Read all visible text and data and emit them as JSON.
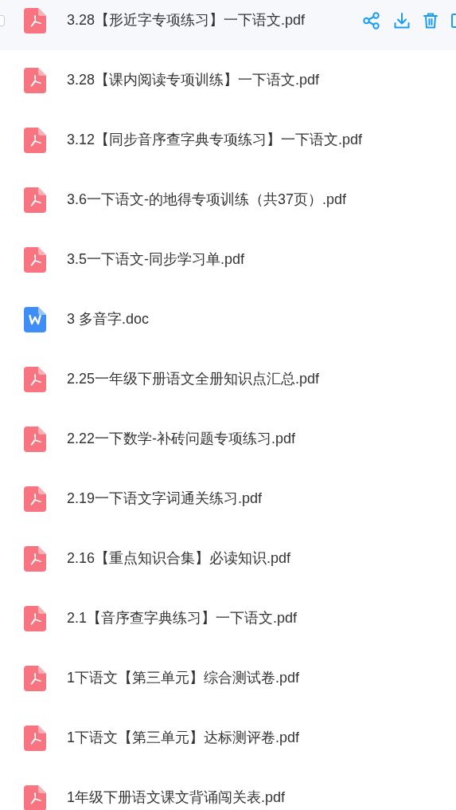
{
  "files": [
    {
      "name": "3.28【形近字专项练习】一下语文.pdf",
      "kind": "pdf",
      "hovered": true
    },
    {
      "name": "3.28【课内阅读专项训练】一下语文.pdf",
      "kind": "pdf",
      "hovered": false
    },
    {
      "name": "3.12【同步音序查字典专项练习】一下语文.pdf",
      "kind": "pdf",
      "hovered": false
    },
    {
      "name": "3.6一下语文-的地得专项训练（共37页）.pdf",
      "kind": "pdf",
      "hovered": false
    },
    {
      "name": "3.5一下语文-同步学习单.pdf",
      "kind": "pdf",
      "hovered": false
    },
    {
      "name": "3 多音字.doc",
      "kind": "doc",
      "hovered": false
    },
    {
      "name": "2.25一年级下册语文全册知识点汇总.pdf",
      "kind": "pdf",
      "hovered": false
    },
    {
      "name": "2.22一下数学-补砖问题专项练习.pdf",
      "kind": "pdf",
      "hovered": false
    },
    {
      "name": "2.19一下语文字词通关练习.pdf",
      "kind": "pdf",
      "hovered": false
    },
    {
      "name": "2.16【重点知识合集】必读知识.pdf",
      "kind": "pdf",
      "hovered": false
    },
    {
      "name": "2.1【音序查字典练习】一下语文.pdf",
      "kind": "pdf",
      "hovered": false
    },
    {
      "name": "1下语文【第三单元】综合测试卷.pdf",
      "kind": "pdf",
      "hovered": false
    },
    {
      "name": "1下语文【第三单元】达标测评卷.pdf",
      "kind": "pdf",
      "hovered": false
    },
    {
      "name": "1年级下册语文课文背诵闯关表.pdf",
      "kind": "pdf",
      "hovered": false
    }
  ]
}
